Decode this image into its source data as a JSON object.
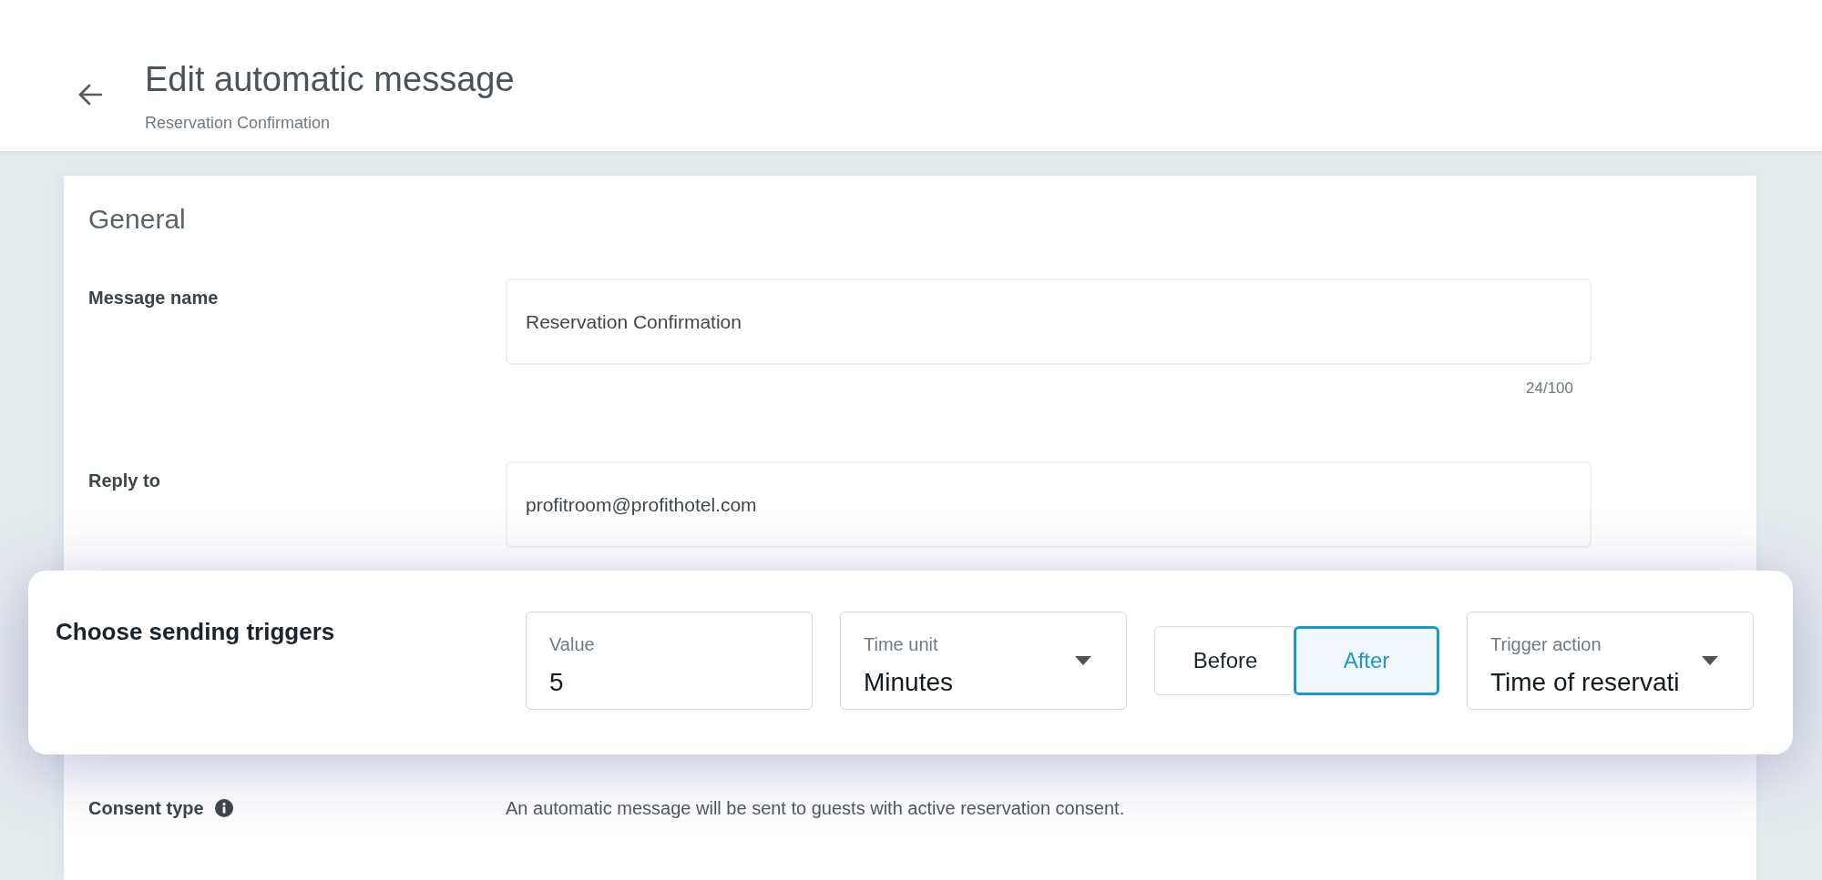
{
  "header": {
    "title": "Edit automatic message",
    "subtitle": "Reservation Confirmation"
  },
  "general": {
    "title": "General",
    "fields": [
      {
        "label": "Message name",
        "value": "Reservation Confirmation",
        "counter": "24/100"
      },
      {
        "label": "Reply to",
        "value": "profitroom@profithotel.com"
      }
    ],
    "consent": {
      "label": "Consent type",
      "text": "An automatic message will be sent to guests with active reservation consent."
    }
  },
  "triggers": {
    "title": "Choose sending triggers",
    "controls": [
      {
        "kind": "input",
        "label": "Value",
        "value": "5"
      },
      {
        "kind": "select",
        "label": "Time unit",
        "value": "Minutes"
      },
      {
        "kind": "toggle",
        "options": [
          {
            "label": "Before",
            "selected": false
          },
          {
            "label": "After",
            "selected": true
          }
        ]
      },
      {
        "kind": "select",
        "label": "Trigger action",
        "value": "Time of reservati"
      }
    ]
  }
}
